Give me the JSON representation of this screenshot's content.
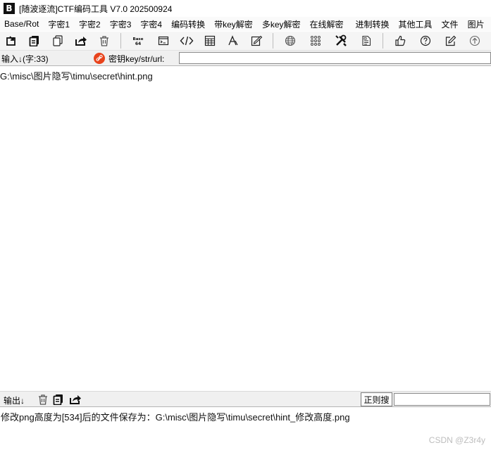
{
  "window": {
    "title": "[随波逐流]CTF编码工具 V7.0  202500924",
    "app_icon_glyph": "B"
  },
  "menu": [
    "Base/Rot",
    "字密1",
    "字密2",
    "字密3",
    "字密4",
    "编码转换",
    "带key解密",
    "多key解密",
    "在线解密",
    "进制转换",
    "其他工具",
    "文件",
    "图片"
  ],
  "toolbar": {
    "buttons": [
      {
        "name": "import-icon"
      },
      {
        "name": "copy-stack-icon"
      },
      {
        "name": "duplicate-icon"
      },
      {
        "name": "share-icon"
      },
      {
        "name": "trash-icon"
      },
      {
        "name": "base64-icon",
        "text_top": "Base",
        "text_bottom": "64"
      },
      {
        "name": "terminal-icon"
      },
      {
        "name": "code-icon"
      },
      {
        "name": "calculator-icon"
      },
      {
        "name": "font-icon"
      },
      {
        "name": "edit-square-icon"
      },
      {
        "name": "globe-icon"
      },
      {
        "name": "grid-icon"
      },
      {
        "name": "tools-icon"
      },
      {
        "name": "document-icon"
      },
      {
        "name": "thumbs-up-icon"
      },
      {
        "name": "help-icon"
      },
      {
        "name": "pencil-box-icon"
      },
      {
        "name": "arrow-up-circle-icon"
      }
    ]
  },
  "input_bar": {
    "label": "输入↓(字:33)",
    "key_label": "密钥key/str/url:",
    "key_value": ""
  },
  "input_text": "G:\\misc\\图片隐写\\timu\\secret\\hint.png",
  "output_bar": {
    "label": "输出↓",
    "regex_button": "正则搜",
    "regex_value": ""
  },
  "output_text": "修改png高度为[534]后的文件保存为：G:\\misc\\图片隐写\\timu\\secret\\hint_修改高度.png",
  "watermark": "CSDN @Z3r4y",
  "colors": {
    "key_icon": "#e8431c",
    "toolbar_bg": "#f5f5f5",
    "bar_bg": "#f0f0f0"
  }
}
